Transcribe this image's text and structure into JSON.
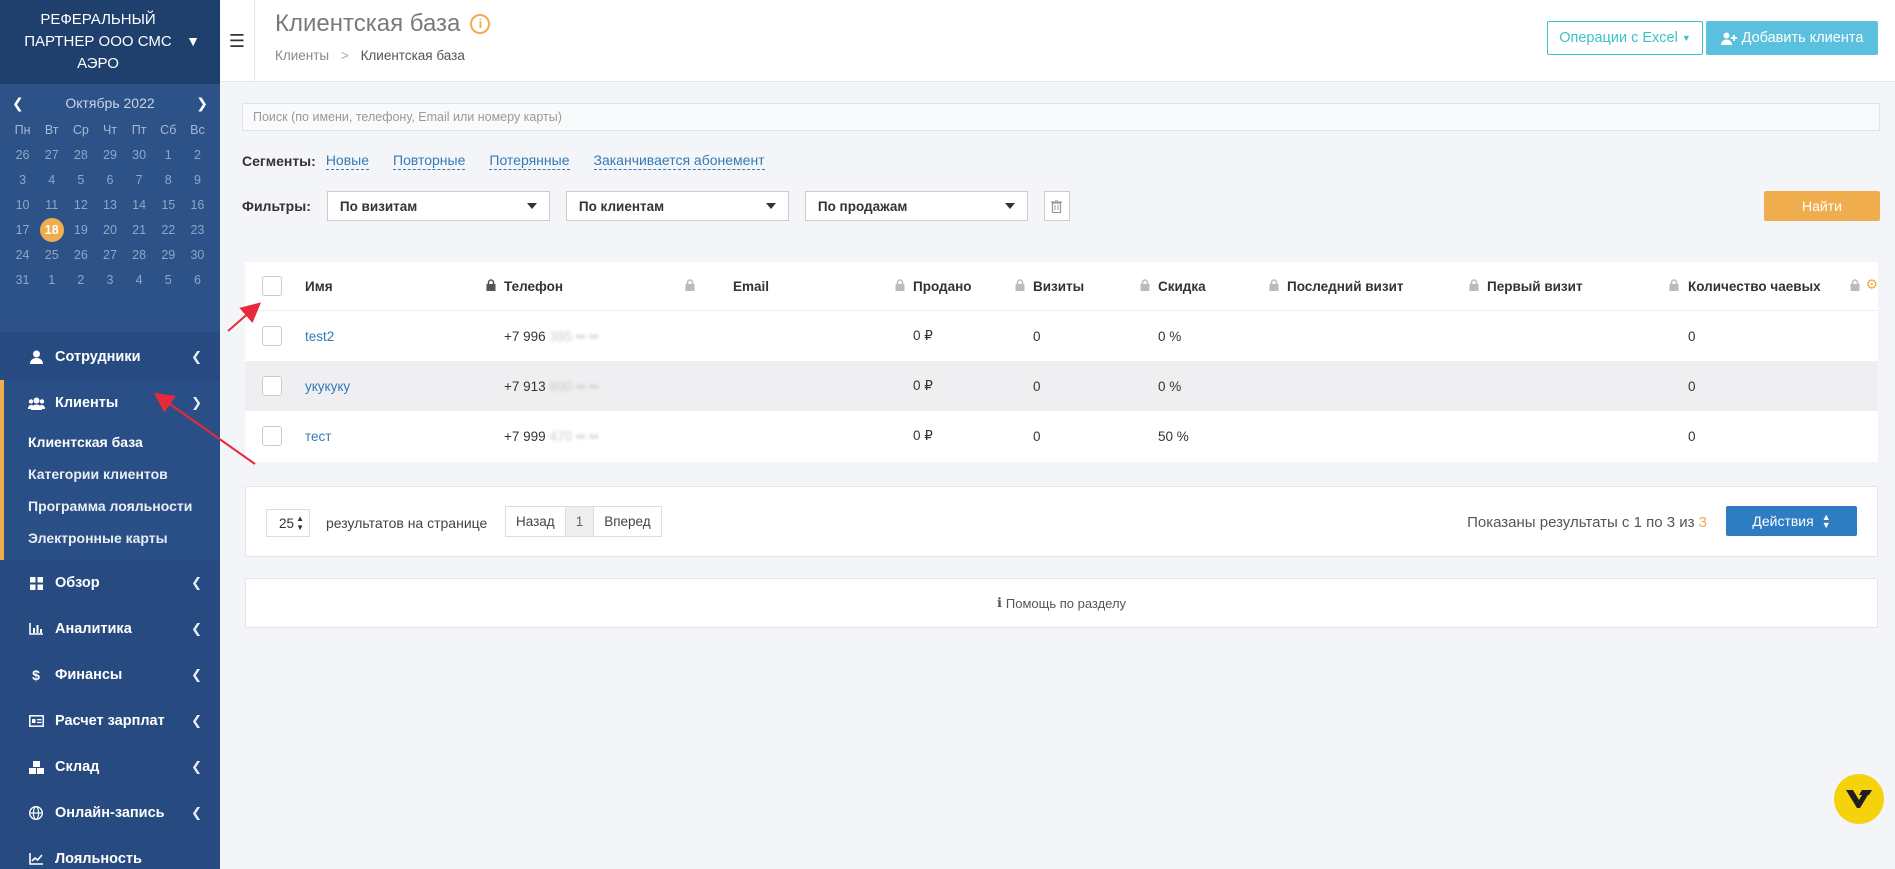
{
  "sidebar": {
    "company": "РЕФЕРАЛЬНЫЙ ПАРТНЕР ООО СМС АЭРО",
    "calendar": {
      "month": "Октябрь 2022",
      "weekdays": [
        "Пн",
        "Вт",
        "Ср",
        "Чт",
        "Пт",
        "Сб",
        "Вс"
      ],
      "weeks": [
        [
          "26",
          "27",
          "28",
          "29",
          "30",
          "1",
          "2"
        ],
        [
          "3",
          "4",
          "5",
          "6",
          "7",
          "8",
          "9"
        ],
        [
          "10",
          "11",
          "12",
          "13",
          "14",
          "15",
          "16"
        ],
        [
          "17",
          "18",
          "19",
          "20",
          "21",
          "22",
          "23"
        ],
        [
          "24",
          "25",
          "26",
          "27",
          "28",
          "29",
          "30"
        ],
        [
          "31",
          "1",
          "2",
          "3",
          "4",
          "5",
          "6"
        ]
      ],
      "today": "18"
    },
    "nav": {
      "staff": "Сотрудники",
      "clients": "Клиенты",
      "clients_sub": [
        "Клиентская база",
        "Категории клиентов",
        "Программа лояльности",
        "Электронные карты"
      ],
      "overview": "Обзор",
      "analytics": "Аналитика",
      "finance": "Финансы",
      "salary": "Расчет зарплат",
      "warehouse": "Склад",
      "online": "Онлайн-запись",
      "loyalty": "Лояльность"
    }
  },
  "header": {
    "title": "Клиентская база",
    "breadcrumb": [
      "Клиенты",
      "Клиентская база"
    ],
    "excel_btn": "Операции с Excel",
    "add_btn": "Добавить клиента"
  },
  "search": {
    "placeholder": "Поиск (по имени, телефону, Email или номеру карты)"
  },
  "segments": {
    "label": "Сегменты:",
    "items": [
      "Новые",
      "Повторные",
      "Потерянные",
      "Заканчивается абонемент"
    ]
  },
  "filters": {
    "label": "Фильтры:",
    "visits": "По визитам",
    "clients": "По клиентам",
    "sales": "По продажам",
    "find": "Найти"
  },
  "table": {
    "columns": [
      "Имя",
      "Телефон",
      "Email",
      "Продано",
      "Визиты",
      "Скидка",
      "Последний визит",
      "Первый визит",
      "Количество чаевых"
    ],
    "rows": [
      {
        "name": "test2",
        "phone": "+7 996",
        "phone_hidden": "395 •• ••",
        "email": "",
        "sold": "0 ₽",
        "visits": "0",
        "discount": "0 %",
        "last": "",
        "first": "",
        "tips": "0"
      },
      {
        "name": "укукуку",
        "phone": "+7 913",
        "phone_hidden": "600 •• ••",
        "email": "",
        "sold": "0 ₽",
        "visits": "0",
        "discount": "0 %",
        "last": "",
        "first": "",
        "tips": "0"
      },
      {
        "name": "тест",
        "phone": "+7 999",
        "phone_hidden": "470 •• ••",
        "email": "",
        "sold": "0 ₽",
        "visits": "0",
        "discount": "50 %",
        "last": "",
        "first": "",
        "tips": "0"
      }
    ]
  },
  "pager": {
    "per_page": "25",
    "per_page_label": "результатов на странице",
    "prev": "Назад",
    "page": "1",
    "next": "Вперед",
    "shown": "Показаны результаты с 1 по 3 из",
    "total": "3",
    "actions": "Действия"
  },
  "help": {
    "label": "Помощь по разделу"
  },
  "colors": {
    "sidebar": "#274b80",
    "accent": "#f0ad4e",
    "link": "#337ab7",
    "teal": "#3bc2c8",
    "primary": "#2e7dc2"
  }
}
